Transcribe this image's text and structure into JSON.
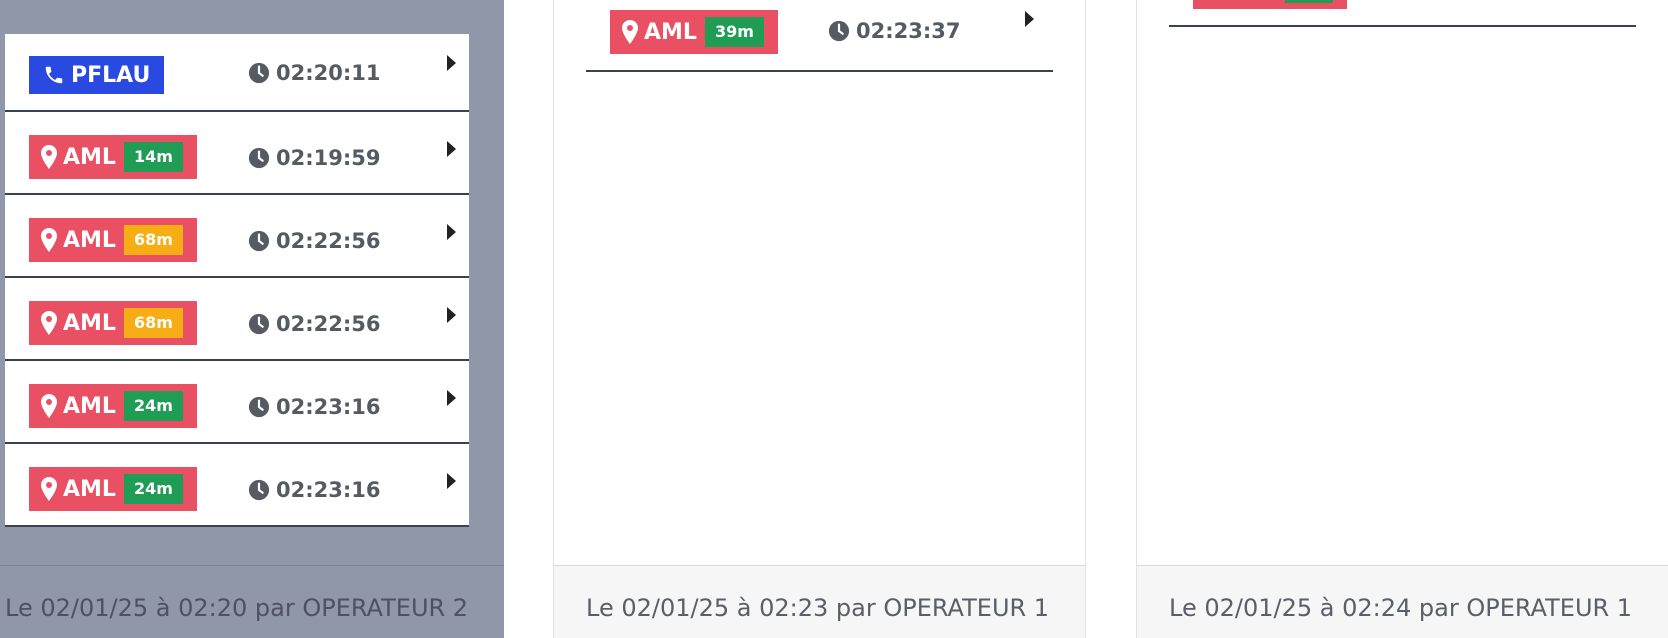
{
  "columns": [
    {
      "footer": "Le 02/01/25 à 02:20 par OPERATEUR 2",
      "rows": [
        {
          "type": "call",
          "label": "PFLAU",
          "time": "02:20:11",
          "icon": "phone-icon"
        },
        {
          "type": "aml",
          "label": "AML",
          "distance": "14m",
          "distance_color": "#1f9d55",
          "time": "02:19:59",
          "icon": "map-pin-icon"
        },
        {
          "type": "aml",
          "label": "AML",
          "distance": "68m",
          "distance_color": "#f7ad14",
          "time": "02:22:56",
          "icon": "map-pin-icon"
        },
        {
          "type": "aml",
          "label": "AML",
          "distance": "68m",
          "distance_color": "#f7ad14",
          "time": "02:22:56",
          "icon": "map-pin-icon"
        },
        {
          "type": "aml",
          "label": "AML",
          "distance": "24m",
          "distance_color": "#1f9d55",
          "time": "02:23:16",
          "icon": "map-pin-icon"
        },
        {
          "type": "aml",
          "label": "AML",
          "distance": "24m",
          "distance_color": "#1f9d55",
          "time": "02:23:16",
          "icon": "map-pin-icon"
        }
      ]
    },
    {
      "footer": "Le 02/01/25 à 02:23 par OPERATEUR 1",
      "rows": [
        {
          "type": "aml",
          "label": "AML",
          "distance": "39m",
          "distance_color": "#1f9d55",
          "time": "02:23:37",
          "icon": "map-pin-icon"
        }
      ]
    },
    {
      "footer": "Le 02/01/25 à 02:24 par OPERATEUR 1",
      "rows": []
    }
  ],
  "colors": {
    "aml_badge": "#ea5064",
    "call_badge": "#2a49e0",
    "green": "#1f9d55",
    "orange": "#f7ad14",
    "column_bg_active": "#9097a8"
  }
}
